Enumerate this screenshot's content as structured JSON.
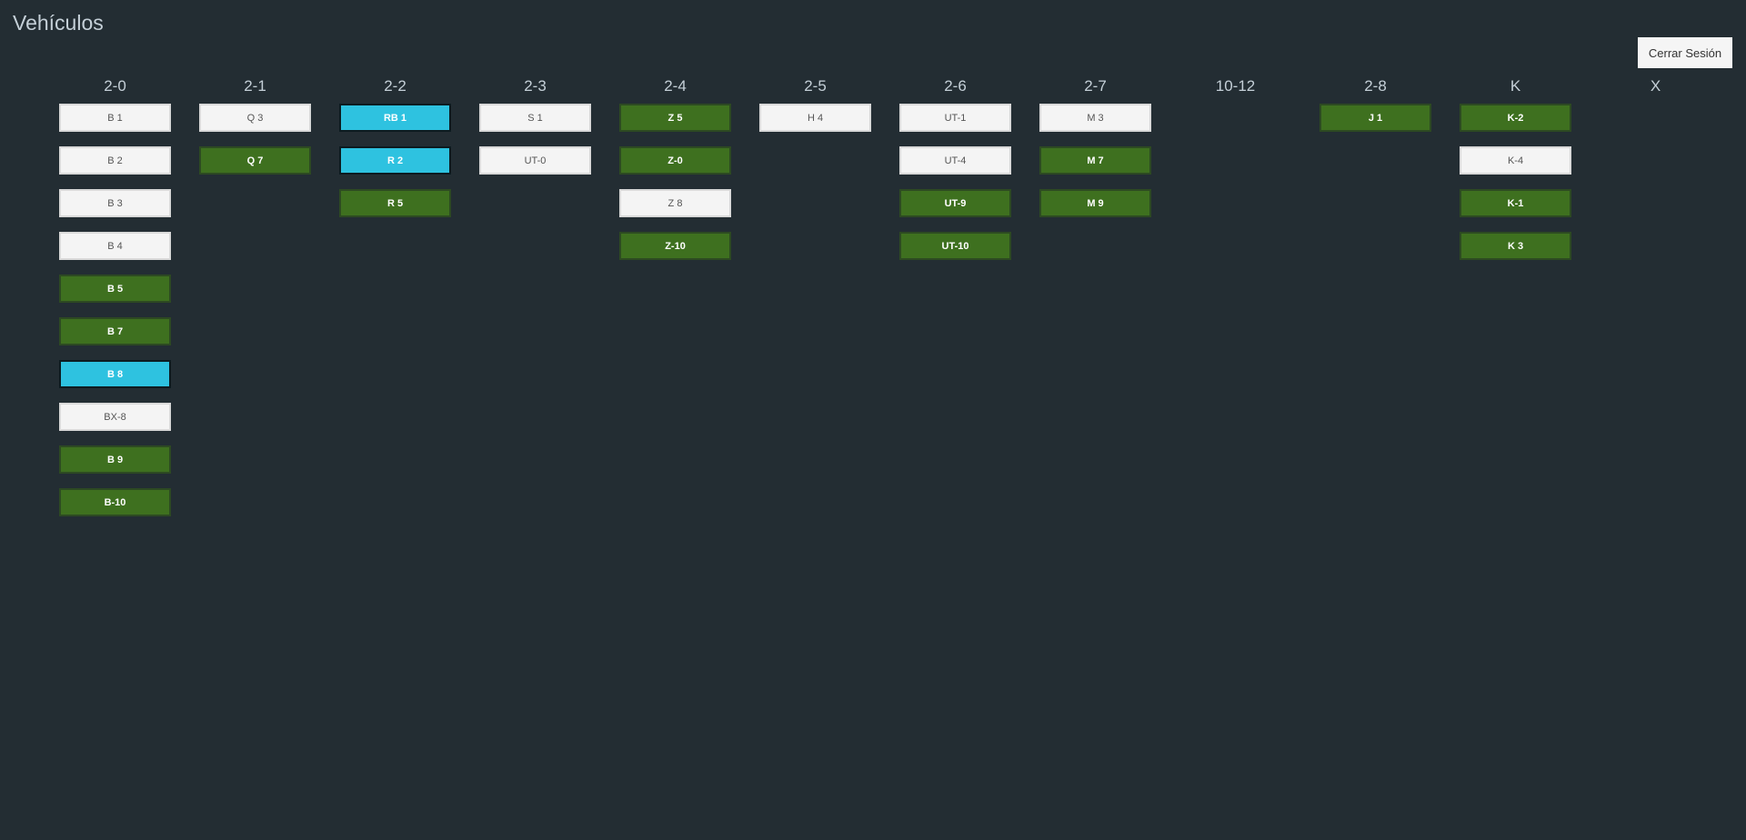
{
  "page": {
    "title": "Vehículos",
    "logout_label": "Cerrar Sesión"
  },
  "status_colors": {
    "white": "#f4f4f4",
    "green": "#3e701f",
    "cyan": "#2ec2e0",
    "background": "#232d33"
  },
  "columns": [
    {
      "label": "2-0",
      "vehicles": [
        {
          "label": "B 1",
          "status": "white"
        },
        {
          "label": "B 2",
          "status": "white"
        },
        {
          "label": "B 3",
          "status": "white"
        },
        {
          "label": "B 4",
          "status": "white"
        },
        {
          "label": "B 5",
          "status": "green"
        },
        {
          "label": "B 7",
          "status": "green"
        },
        {
          "label": "B 8",
          "status": "cyan"
        },
        {
          "label": "BX-8",
          "status": "white"
        },
        {
          "label": "B 9",
          "status": "green"
        },
        {
          "label": "B-10",
          "status": "green"
        }
      ]
    },
    {
      "label": "2-1",
      "vehicles": [
        {
          "label": "Q 3",
          "status": "white"
        },
        {
          "label": "Q 7",
          "status": "green"
        }
      ]
    },
    {
      "label": "2-2",
      "vehicles": [
        {
          "label": "RB 1",
          "status": "cyan"
        },
        {
          "label": "R 2",
          "status": "cyan"
        },
        {
          "label": "R 5",
          "status": "green"
        }
      ]
    },
    {
      "label": "2-3",
      "vehicles": [
        {
          "label": "S 1",
          "status": "white"
        },
        {
          "label": "UT-0",
          "status": "white"
        }
      ]
    },
    {
      "label": "2-4",
      "vehicles": [
        {
          "label": "Z 5",
          "status": "green"
        },
        {
          "label": "Z-0",
          "status": "green"
        },
        {
          "label": "Z 8",
          "status": "white"
        },
        {
          "label": "Z-10",
          "status": "green"
        }
      ]
    },
    {
      "label": "2-5",
      "vehicles": [
        {
          "label": "H 4",
          "status": "white"
        }
      ]
    },
    {
      "label": "2-6",
      "vehicles": [
        {
          "label": "UT-1",
          "status": "white"
        },
        {
          "label": "UT-4",
          "status": "white"
        },
        {
          "label": "UT-9",
          "status": "green"
        },
        {
          "label": "UT-10",
          "status": "green"
        }
      ]
    },
    {
      "label": "2-7",
      "vehicles": [
        {
          "label": "M 3",
          "status": "white"
        },
        {
          "label": "M 7",
          "status": "green"
        },
        {
          "label": "M 9",
          "status": "green"
        }
      ]
    },
    {
      "label": "10-12",
      "vehicles": []
    },
    {
      "label": "2-8",
      "vehicles": [
        {
          "label": "J 1",
          "status": "green"
        }
      ]
    },
    {
      "label": "K",
      "vehicles": [
        {
          "label": "K-2",
          "status": "green"
        },
        {
          "label": "K-4",
          "status": "white"
        },
        {
          "label": "K-1",
          "status": "green"
        },
        {
          "label": "K 3",
          "status": "green"
        }
      ]
    },
    {
      "label": "X",
      "vehicles": []
    }
  ]
}
